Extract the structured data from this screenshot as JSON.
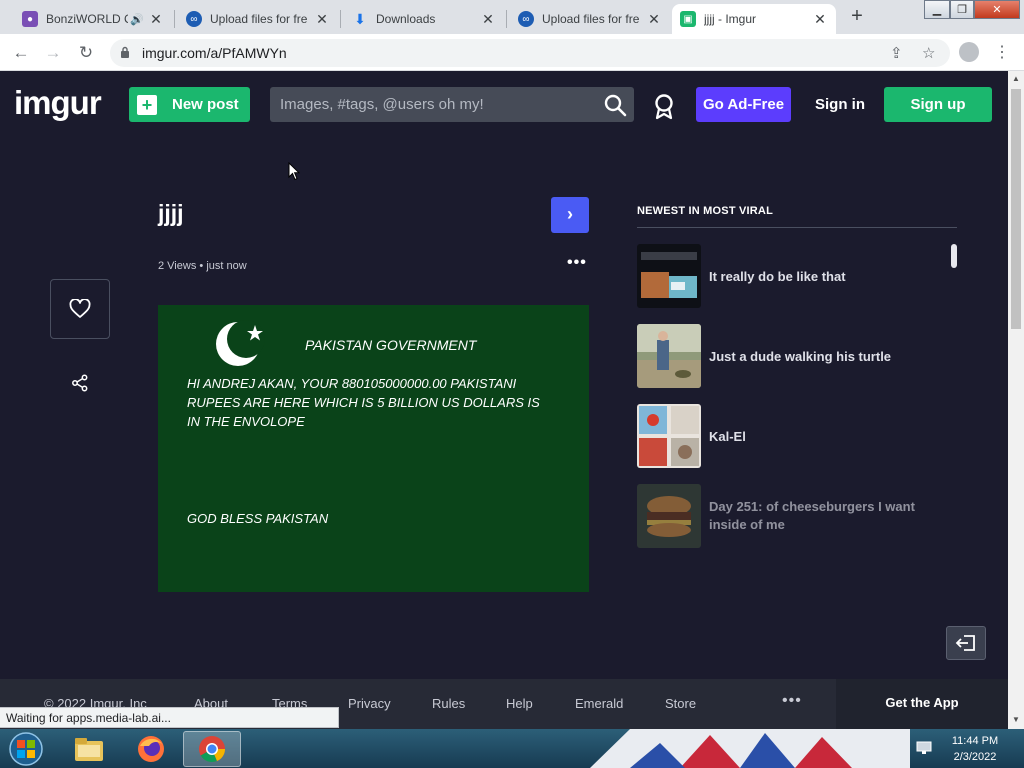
{
  "browser": {
    "tabs": [
      {
        "title": "BonziWORLD C",
        "favicon": "bonzi-icon",
        "audio": true
      },
      {
        "title": "Upload files for fre",
        "favicon": "media-lab-icon"
      },
      {
        "title": "Downloads",
        "favicon": "download-icon"
      },
      {
        "title": "Upload files for fre",
        "favicon": "media-lab-icon"
      },
      {
        "title": "jjjj - Imgur",
        "favicon": "imgur-icon",
        "active": true
      }
    ],
    "url": "imgur.com/a/PfAMWYn",
    "status": "Waiting for apps.media-lab.ai..."
  },
  "header": {
    "logo": "imgur",
    "new_post": "New post",
    "search_placeholder": "Images, #tags, @users oh my!",
    "ad_free": "Go Ad-Free",
    "sign_in": "Sign in",
    "sign_up": "Sign up"
  },
  "post": {
    "title": "jjjj",
    "views": "2 Views",
    "time": "just now",
    "image": {
      "heading": "PAKISTAN GOVERNMENT",
      "body": "HI ANDREJ AKAN, YOUR 880105000000.00 PAKISTANI RUPEES ARE HERE WHICH IS 5 BILLION US DOLLARS IS IN THE ENVOLOPE",
      "footer": "GOD BLESS PAKISTAN",
      "background": "#0a4319"
    }
  },
  "sidebar": {
    "title": "NEWEST IN MOST VIRAL",
    "items": [
      {
        "label": "It really do be like that"
      },
      {
        "label": "Just a dude walking his turtle"
      },
      {
        "label": "Kal-El"
      },
      {
        "label": "Day 251: of cheeseburgers I want inside of me"
      }
    ]
  },
  "footer": {
    "copyright": "© 2022 Imgur, Inc",
    "links": [
      "About",
      "Terms",
      "Privacy",
      "Rules",
      "Help",
      "Emerald",
      "Store"
    ],
    "more": "•••",
    "get_app": "Get the App"
  },
  "taskbar": {
    "time": "11:44 PM",
    "date": "2/3/2022"
  },
  "colors": {
    "page_bg": "#1b1b2d",
    "green": "#1bb76e",
    "purple": "#5c3dfd",
    "next_blue": "#4a5bf4"
  }
}
